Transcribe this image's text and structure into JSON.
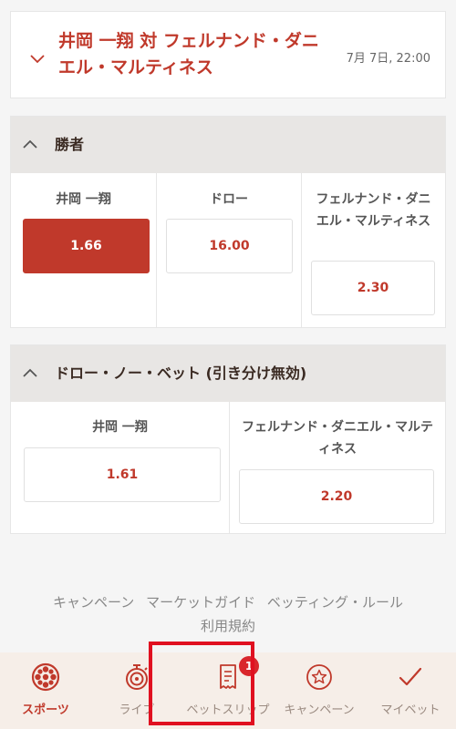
{
  "match": {
    "title": "井岡 一翔 対 フェルナンド・ダニエル・マルティネス",
    "time": "7月 7日, 22:00"
  },
  "markets": [
    {
      "title": "勝者",
      "outcomes": [
        {
          "name": "井岡 一翔",
          "odds": "1.66",
          "selected": true
        },
        {
          "name": "ドロー",
          "odds": "16.00",
          "selected": false
        },
        {
          "name": "フェルナンド・ダニエル・マルティネス",
          "odds": "2.30",
          "selected": false
        }
      ]
    },
    {
      "title": "ドロー・ノー・ベット (引き分け無効)",
      "outcomes": [
        {
          "name": "井岡 一翔",
          "odds": "1.61",
          "selected": false
        },
        {
          "name": "フェルナンド・ダニエル・マルティネス",
          "odds": "2.20",
          "selected": false
        }
      ]
    }
  ],
  "footer": {
    "links": [
      "キャンペーン",
      "マーケットガイド",
      "ベッティング・ルール",
      "利用規約"
    ]
  },
  "nav": {
    "items": [
      {
        "label": "スポーツ",
        "icon": "sports-ball-icon",
        "active": true
      },
      {
        "label": "ライブ",
        "icon": "stopwatch-icon",
        "active": false
      },
      {
        "label": "ベットスリップ",
        "icon": "receipt-icon",
        "active": false,
        "badge": "1"
      },
      {
        "label": "キャンペーン",
        "icon": "star-icon",
        "active": false
      },
      {
        "label": "マイベット",
        "icon": "checkmark-icon",
        "active": false
      }
    ]
  },
  "colors": {
    "accent": "#c0392b",
    "badge": "#d9262c",
    "highlight": "#e01020",
    "nav_bg": "#f6eee8"
  }
}
